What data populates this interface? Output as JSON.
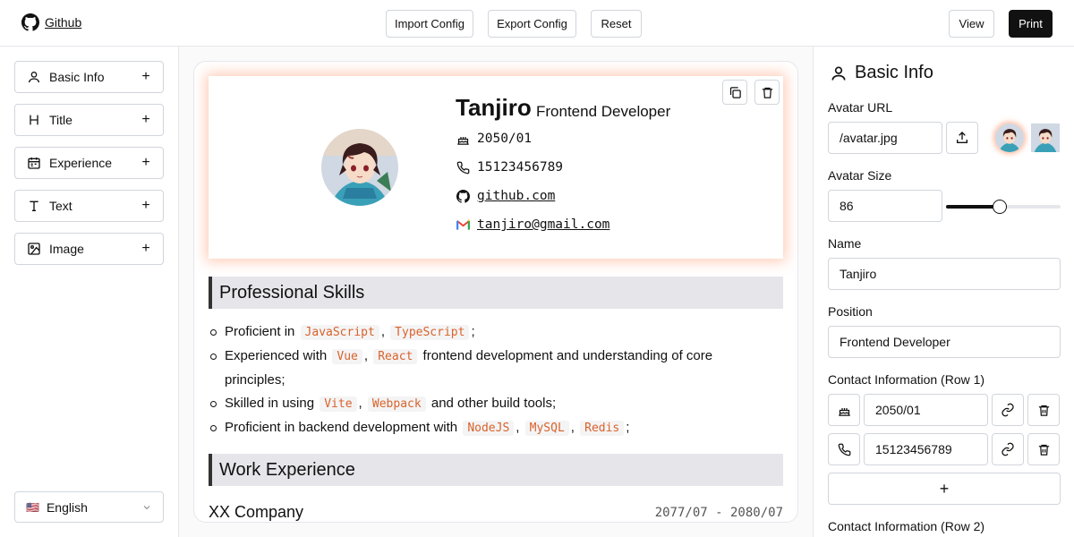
{
  "topbar": {
    "brand": "Github",
    "import_label": "Import Config",
    "export_label": "Export Config",
    "reset_label": "Reset",
    "view_label": "View",
    "print_label": "Print"
  },
  "blocks": [
    {
      "label": "Basic Info",
      "icon": "user-icon"
    },
    {
      "label": "Title",
      "icon": "heading-icon"
    },
    {
      "label": "Experience",
      "icon": "calendar-icon"
    },
    {
      "label": "Text",
      "icon": "text-icon"
    },
    {
      "label": "Image",
      "icon": "image-icon"
    }
  ],
  "language": {
    "flag": "🇺🇸",
    "label": "English"
  },
  "resume": {
    "name": "Tanjiro",
    "position": "Frontend Developer",
    "contacts": [
      {
        "icon": "cake-icon",
        "text": "2050/01"
      },
      {
        "icon": "phone-icon",
        "text": "15123456789"
      },
      {
        "icon": "github-icon",
        "text": "github.com"
      },
      {
        "icon": "gmail-icon",
        "text": "tanjiro@gmail.com"
      }
    ],
    "skills_title": "Professional Skills",
    "skills": [
      {
        "prefix": "Proficient in",
        "codes": [
          "JavaScript",
          "TypeScript"
        ],
        "suffix": ";"
      },
      {
        "prefix": "Experienced with",
        "codes": [
          "Vue",
          "React"
        ],
        "suffix": "frontend development and understanding of core principles;"
      },
      {
        "prefix": "Skilled in using",
        "codes": [
          "Vite",
          "Webpack"
        ],
        "suffix": "and other build tools;"
      },
      {
        "prefix": "Proficient in backend development with",
        "codes": [
          "NodeJS",
          "MySQL",
          "Redis"
        ],
        "suffix": ";"
      }
    ],
    "work_title": "Work Experience",
    "company": "XX Company",
    "dates": "2077/07 - 2080/07"
  },
  "panel": {
    "title": "Basic Info",
    "avatar_url_label": "Avatar URL",
    "avatar_url": "/avatar.jpg",
    "avatar_size_label": "Avatar Size",
    "avatar_size": "86",
    "avatar_size_slider": 0.47,
    "name_label": "Name",
    "name": "Tanjiro",
    "position_label": "Position",
    "position": "Frontend Developer",
    "contact_row1_label": "Contact Information (Row 1)",
    "row1": [
      {
        "icon": "cake-icon",
        "value": "2050/01"
      },
      {
        "icon": "phone-icon",
        "value": "15123456789"
      }
    ],
    "add_symbol": "+",
    "contact_row2_label": "Contact Information (Row 2)"
  },
  "colors": {
    "accent": "#111111",
    "code": "#d9622b",
    "glow": "#ff8c5a"
  }
}
